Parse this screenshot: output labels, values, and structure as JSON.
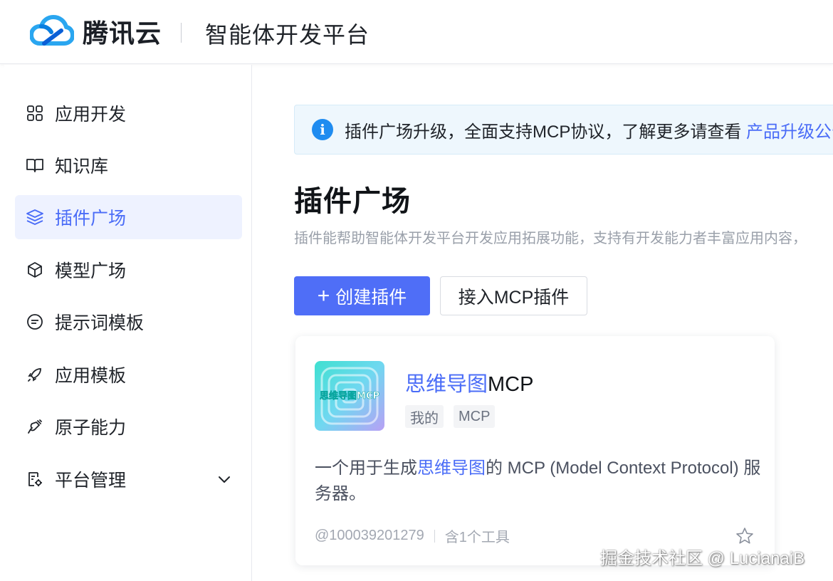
{
  "header": {
    "brand": "腾讯云",
    "platform": "智能体开发平台"
  },
  "sidebar": {
    "items": [
      {
        "label": "应用开发",
        "icon": "grid-icon"
      },
      {
        "label": "知识库",
        "icon": "book-icon"
      },
      {
        "label": "插件广场",
        "icon": "layers-icon",
        "active": true
      },
      {
        "label": "模型广场",
        "icon": "cube-icon"
      },
      {
        "label": "提示词模板",
        "icon": "chat-icon"
      },
      {
        "label": "应用模板",
        "icon": "rocket-icon"
      },
      {
        "label": "原子能力",
        "icon": "plug-icon"
      },
      {
        "label": "平台管理",
        "icon": "settings-doc-icon",
        "expandable": true
      }
    ]
  },
  "notice": {
    "text": "插件广场升级，全面支持MCP协议，了解更多请查看 ",
    "link": "产品升级公告"
  },
  "main": {
    "title": "插件广场",
    "description": "插件能帮助智能体开发平台开发应用拓展功能，支持有开发能力者丰富应用内容，",
    "create_button": "创建插件",
    "mcp_button": "接入MCP插件"
  },
  "card": {
    "thumb_text": "思维导图MCP",
    "title_highlight": "思维导图",
    "title_rest": "MCP",
    "tags": [
      "我的",
      "MCP"
    ],
    "desc_prefix": "一个用于生成",
    "desc_highlight": "思维导图",
    "desc_suffix": "的 MCP (Model Context Protocol) 服务器。",
    "author": "@100039201279",
    "tools": "含1个工具"
  },
  "watermark": "掘金技术社区 @ LucianaiB",
  "colors": {
    "accent": "#4f6ef7",
    "link": "#4a6cf7",
    "notice_bg": "#eef7fd",
    "active_bg": "#eef2ff"
  }
}
